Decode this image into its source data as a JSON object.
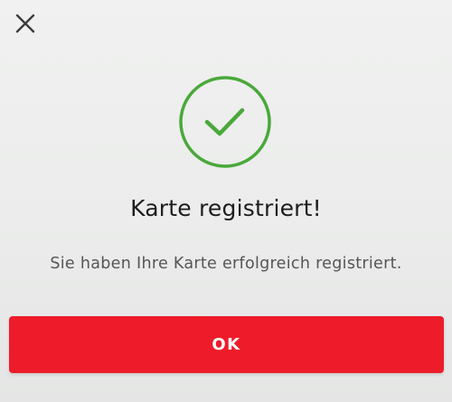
{
  "dialog": {
    "close_icon": "close-icon",
    "status_icon": "checkmark-circle-icon",
    "title": "Karte registriert!",
    "message": "Sie haben Ihre Karte erfolgreich registriert.",
    "ok_label": "OK"
  },
  "colors": {
    "success": "#4aa83b",
    "primary_button": "#ee1c2a",
    "title_text": "#1d1d1d",
    "message_text": "#555555"
  }
}
